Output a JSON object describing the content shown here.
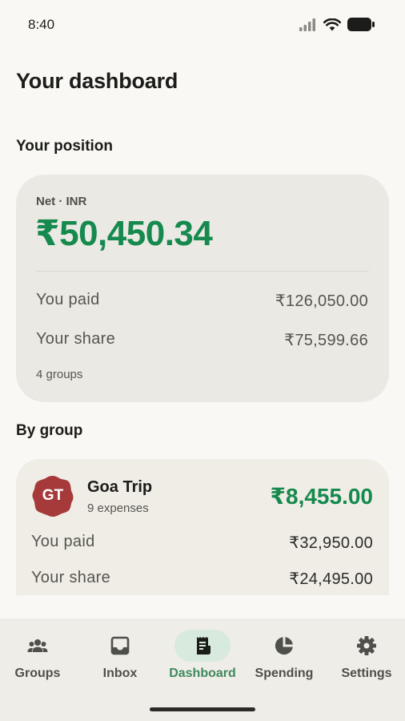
{
  "status_bar": {
    "time": "8:40"
  },
  "page": {
    "title": "Your dashboard"
  },
  "position": {
    "section_title": "Your position",
    "net_label": "Net · INR",
    "net_value": "₹50,450.34",
    "you_paid_label": "You paid",
    "you_paid_value": "₹126,050.00",
    "your_share_label": "Your share",
    "your_share_value": "₹75,599.66",
    "groups_count": "4 groups"
  },
  "by_group": {
    "section_title": "By group",
    "groups": [
      {
        "initials": "GT",
        "name": "Goa Trip",
        "expenses": "9 expenses",
        "net": "₹8,455.00",
        "you_paid_label": "You paid",
        "you_paid_value": "₹32,950.00",
        "your_share_label": "Your share",
        "your_share_value": "₹24,495.00",
        "avatar_color": "#a63a3a"
      }
    ]
  },
  "nav": {
    "items": [
      {
        "label": "Groups",
        "icon": "groups-icon"
      },
      {
        "label": "Inbox",
        "icon": "inbox-icon"
      },
      {
        "label": "Dashboard",
        "icon": "dashboard-icon",
        "active": true
      },
      {
        "label": "Spending",
        "icon": "pie-chart-icon"
      },
      {
        "label": "Settings",
        "icon": "gear-icon"
      }
    ]
  },
  "colors": {
    "accent_green": "#168a4e",
    "nav_active": "#3f8a5f",
    "background": "#f9f8f4"
  }
}
